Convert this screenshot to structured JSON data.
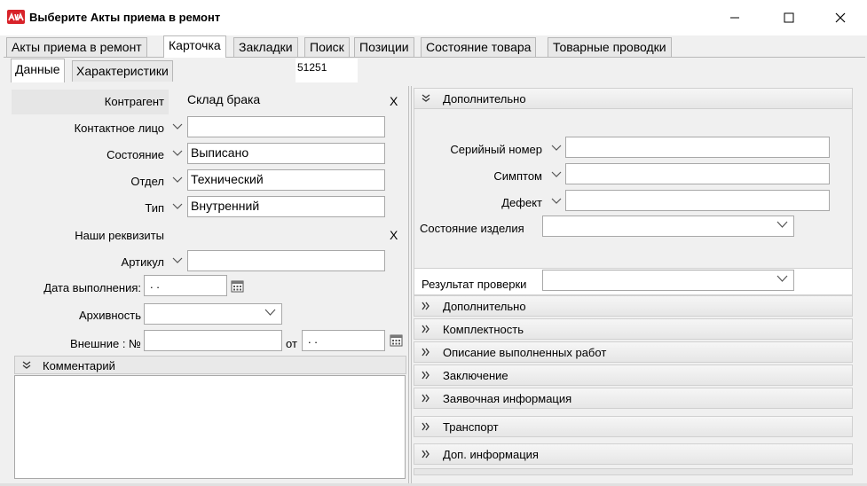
{
  "window": {
    "title": "Выберите Акты приема в ремонт",
    "icon": "app-logo-icon",
    "buttons": [
      "minimize-icon",
      "maximize-icon",
      "close-icon"
    ]
  },
  "tabs": [
    {
      "label": "Акты приема в ремонт",
      "active": false
    },
    {
      "label": "Карточка",
      "active": true
    },
    {
      "label": "Закладки",
      "active": false
    },
    {
      "label": "Поиск",
      "active": false
    },
    {
      "label": "Позиции",
      "active": false
    },
    {
      "label": "Состояние товара",
      "active": false
    },
    {
      "label": "Товарные проводки",
      "active": false
    }
  ],
  "subtabs": [
    {
      "label": "Данные",
      "active": true
    },
    {
      "label": "Характеристики",
      "active": false
    }
  ],
  "doc_number": "51251",
  "left": {
    "contragent_label": "Контрагент",
    "contragent_value": "Склад брака",
    "contact_label": "Контактное лицо",
    "contact_value": "",
    "state_label": "Состояние",
    "state_value": "Выписано",
    "dept_label": "Отдел",
    "dept_value": "Технический",
    "type_label": "Тип",
    "type_value": "Внутренний",
    "requisites_label": "Наши реквизиты",
    "article_label": "Артикул",
    "article_value": "",
    "date_label": "Дата выполнения:",
    "date_value": " .  .",
    "archive_label": "Архивность",
    "archive_value": "",
    "external_label": "Внешние : №",
    "external_value": "",
    "from_label": "от",
    "from_date": " .  .",
    "clear_symbol": "X",
    "comment_title": "Комментарий",
    "comment_value": ""
  },
  "right": {
    "section_open": "Дополнительно",
    "serial_label": "Серийный номер",
    "serial_value": "",
    "symptom_label": "Симптом",
    "symptom_value": "",
    "defect_label": "Дефект",
    "defect_value": "",
    "product_state_label": "Состояние изделия",
    "product_state_value": "",
    "check_result_label": "Результат проверки",
    "check_result_value": "",
    "sections": [
      "Дополнительно",
      "Комплектность",
      "Описание выполненных работ",
      "Заключение",
      "Заявочная информация",
      "Транспорт",
      "Доп. информация"
    ]
  }
}
